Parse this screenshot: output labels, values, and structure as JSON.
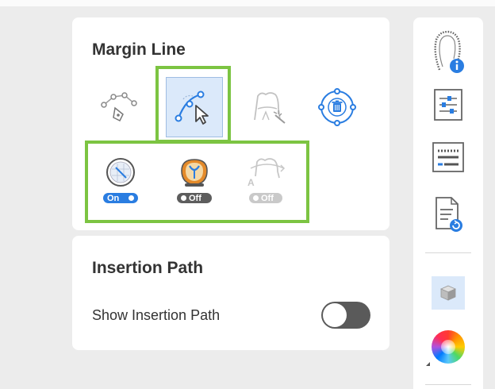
{
  "margin_line": {
    "title": "Margin Line",
    "tools": [
      {
        "icon": "curve-edit-icon",
        "active": false
      },
      {
        "icon": "curve-select-icon",
        "active": true
      },
      {
        "icon": "detect-margin-icon",
        "active": false
      },
      {
        "icon": "delete-icon",
        "active": false
      }
    ],
    "toggles": [
      {
        "icon": "grid-view-icon",
        "state": "On",
        "enabled": true
      },
      {
        "icon": "die-view-icon",
        "state": "Off",
        "enabled": true
      },
      {
        "icon": "auto-margin-icon",
        "state": "Off",
        "enabled": false
      }
    ]
  },
  "insertion_path": {
    "title": "Insertion Path",
    "show_label": "Show Insertion Path",
    "toggle_on": false
  },
  "sidebar": {
    "items": [
      {
        "icon": "tooth-info-icon"
      },
      {
        "icon": "sliders-icon"
      },
      {
        "icon": "keyboard-icon"
      },
      {
        "icon": "document-refresh-icon"
      },
      {
        "icon": "cube-icon"
      },
      {
        "icon": "color-wheel-icon"
      }
    ]
  },
  "colors": {
    "accent_green": "#7cc442",
    "accent_blue": "#2a7de1",
    "active_bg": "#dbe9fa"
  }
}
